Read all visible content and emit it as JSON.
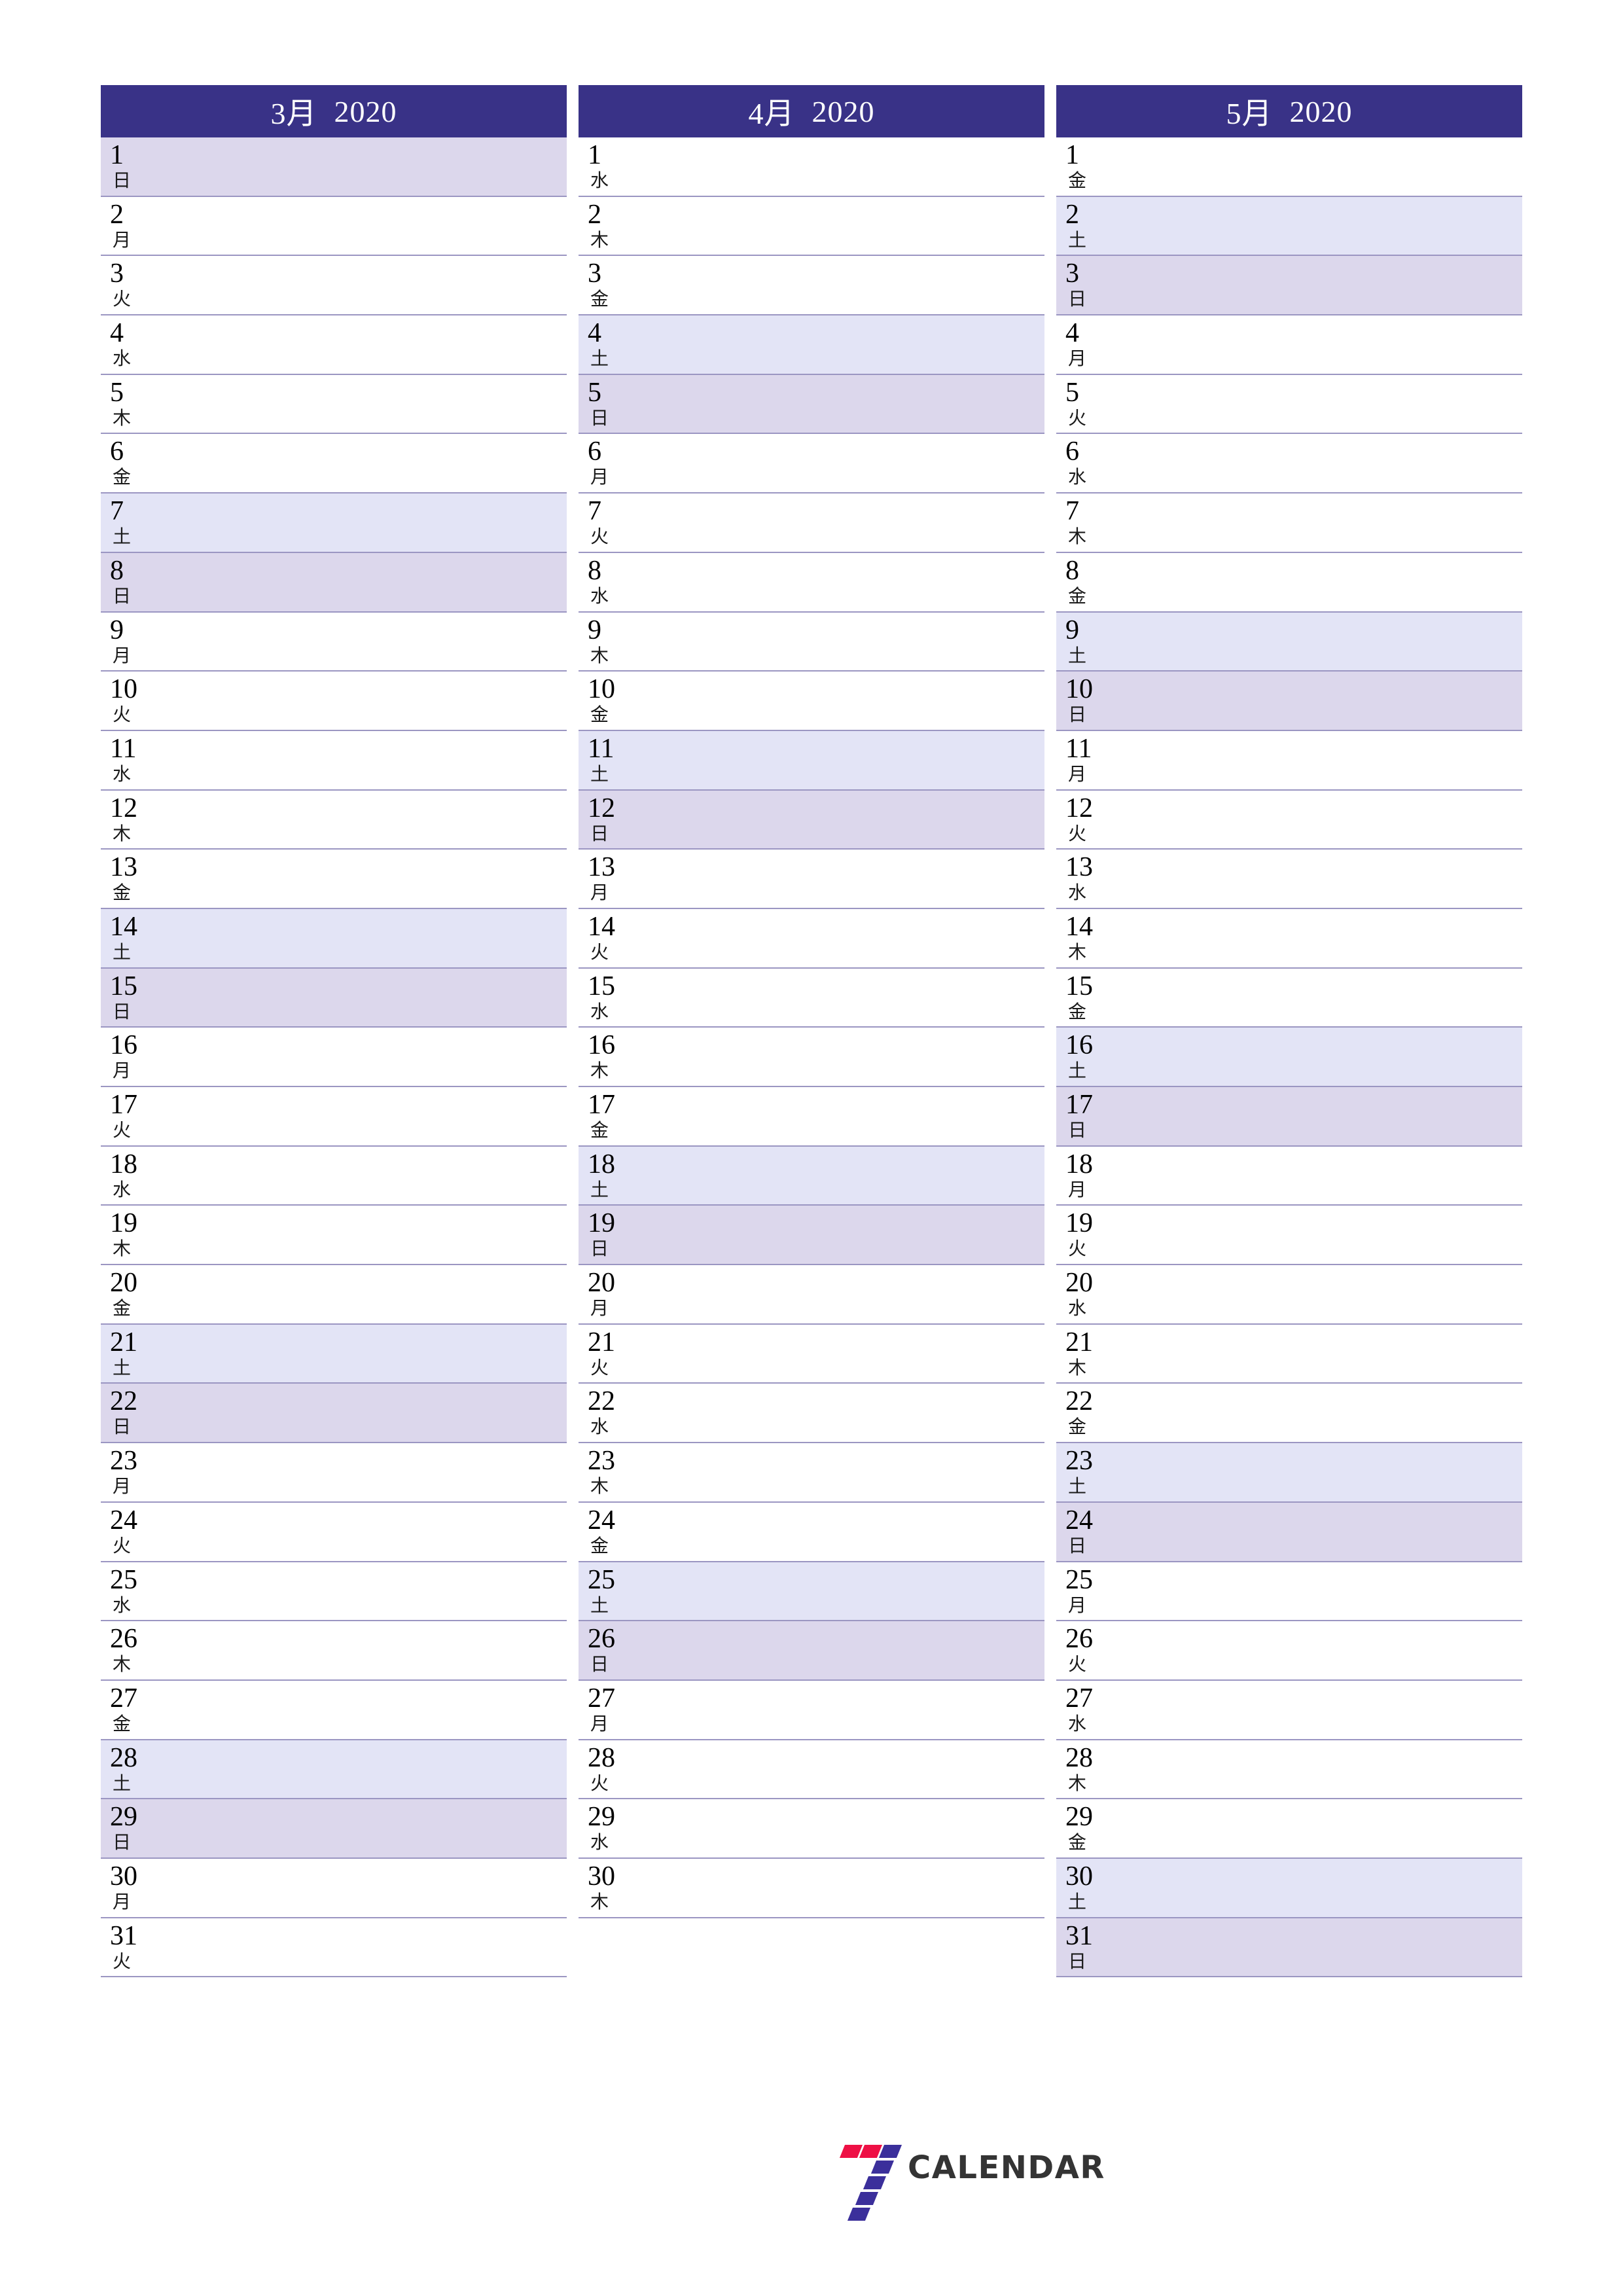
{
  "page": {
    "title": "3月 2020 / 4月 2020 / 5月 2020",
    "orientation": "portrait",
    "colors": {
      "header_background": "#393287",
      "header_text": "#ffffff",
      "saturday_background": "#e3e4f6",
      "sunday_background": "#dcd7ec",
      "row_separator": "#9b96c2",
      "logo_red": "#ee1045",
      "logo_blue": "#3b2f9b",
      "logo_word": "#343434"
    }
  },
  "brand": {
    "mark_name": "seven-logo-icon",
    "wordmark": "CALENDAR"
  },
  "months": [
    {
      "header": {
        "month": "3月",
        "year": "2020"
      },
      "days": [
        {
          "num": "1",
          "weekday": "日",
          "type": "sun"
        },
        {
          "num": "2",
          "weekday": "月",
          "type": "weekday"
        },
        {
          "num": "3",
          "weekday": "火",
          "type": "weekday"
        },
        {
          "num": "4",
          "weekday": "水",
          "type": "weekday"
        },
        {
          "num": "5",
          "weekday": "木",
          "type": "weekday"
        },
        {
          "num": "6",
          "weekday": "金",
          "type": "weekday"
        },
        {
          "num": "7",
          "weekday": "土",
          "type": "sat"
        },
        {
          "num": "8",
          "weekday": "日",
          "type": "sun"
        },
        {
          "num": "9",
          "weekday": "月",
          "type": "weekday"
        },
        {
          "num": "10",
          "weekday": "火",
          "type": "weekday"
        },
        {
          "num": "11",
          "weekday": "水",
          "type": "weekday"
        },
        {
          "num": "12",
          "weekday": "木",
          "type": "weekday"
        },
        {
          "num": "13",
          "weekday": "金",
          "type": "weekday"
        },
        {
          "num": "14",
          "weekday": "土",
          "type": "sat"
        },
        {
          "num": "15",
          "weekday": "日",
          "type": "sun"
        },
        {
          "num": "16",
          "weekday": "月",
          "type": "weekday"
        },
        {
          "num": "17",
          "weekday": "火",
          "type": "weekday"
        },
        {
          "num": "18",
          "weekday": "水",
          "type": "weekday"
        },
        {
          "num": "19",
          "weekday": "木",
          "type": "weekday"
        },
        {
          "num": "20",
          "weekday": "金",
          "type": "weekday"
        },
        {
          "num": "21",
          "weekday": "土",
          "type": "sat"
        },
        {
          "num": "22",
          "weekday": "日",
          "type": "sun"
        },
        {
          "num": "23",
          "weekday": "月",
          "type": "weekday"
        },
        {
          "num": "24",
          "weekday": "火",
          "type": "weekday"
        },
        {
          "num": "25",
          "weekday": "水",
          "type": "weekday"
        },
        {
          "num": "26",
          "weekday": "木",
          "type": "weekday"
        },
        {
          "num": "27",
          "weekday": "金",
          "type": "weekday"
        },
        {
          "num": "28",
          "weekday": "土",
          "type": "sat"
        },
        {
          "num": "29",
          "weekday": "日",
          "type": "sun"
        },
        {
          "num": "30",
          "weekday": "月",
          "type": "weekday"
        },
        {
          "num": "31",
          "weekday": "火",
          "type": "weekday"
        }
      ]
    },
    {
      "header": {
        "month": "4月",
        "year": "2020"
      },
      "days": [
        {
          "num": "1",
          "weekday": "水",
          "type": "weekday"
        },
        {
          "num": "2",
          "weekday": "木",
          "type": "weekday"
        },
        {
          "num": "3",
          "weekday": "金",
          "type": "weekday"
        },
        {
          "num": "4",
          "weekday": "土",
          "type": "sat"
        },
        {
          "num": "5",
          "weekday": "日",
          "type": "sun"
        },
        {
          "num": "6",
          "weekday": "月",
          "type": "weekday"
        },
        {
          "num": "7",
          "weekday": "火",
          "type": "weekday"
        },
        {
          "num": "8",
          "weekday": "水",
          "type": "weekday"
        },
        {
          "num": "9",
          "weekday": "木",
          "type": "weekday"
        },
        {
          "num": "10",
          "weekday": "金",
          "type": "weekday"
        },
        {
          "num": "11",
          "weekday": "土",
          "type": "sat"
        },
        {
          "num": "12",
          "weekday": "日",
          "type": "sun"
        },
        {
          "num": "13",
          "weekday": "月",
          "type": "weekday"
        },
        {
          "num": "14",
          "weekday": "火",
          "type": "weekday"
        },
        {
          "num": "15",
          "weekday": "水",
          "type": "weekday"
        },
        {
          "num": "16",
          "weekday": "木",
          "type": "weekday"
        },
        {
          "num": "17",
          "weekday": "金",
          "type": "weekday"
        },
        {
          "num": "18",
          "weekday": "土",
          "type": "sat"
        },
        {
          "num": "19",
          "weekday": "日",
          "type": "sun"
        },
        {
          "num": "20",
          "weekday": "月",
          "type": "weekday"
        },
        {
          "num": "21",
          "weekday": "火",
          "type": "weekday"
        },
        {
          "num": "22",
          "weekday": "水",
          "type": "weekday"
        },
        {
          "num": "23",
          "weekday": "木",
          "type": "weekday"
        },
        {
          "num": "24",
          "weekday": "金",
          "type": "weekday"
        },
        {
          "num": "25",
          "weekday": "土",
          "type": "sat"
        },
        {
          "num": "26",
          "weekday": "日",
          "type": "sun"
        },
        {
          "num": "27",
          "weekday": "月",
          "type": "weekday"
        },
        {
          "num": "28",
          "weekday": "火",
          "type": "weekday"
        },
        {
          "num": "29",
          "weekday": "水",
          "type": "weekday"
        },
        {
          "num": "30",
          "weekday": "木",
          "type": "weekday"
        }
      ]
    },
    {
      "header": {
        "month": "5月",
        "year": "2020"
      },
      "days": [
        {
          "num": "1",
          "weekday": "金",
          "type": "weekday"
        },
        {
          "num": "2",
          "weekday": "土",
          "type": "sat"
        },
        {
          "num": "3",
          "weekday": "日",
          "type": "sun"
        },
        {
          "num": "4",
          "weekday": "月",
          "type": "weekday"
        },
        {
          "num": "5",
          "weekday": "火",
          "type": "weekday"
        },
        {
          "num": "6",
          "weekday": "水",
          "type": "weekday"
        },
        {
          "num": "7",
          "weekday": "木",
          "type": "weekday"
        },
        {
          "num": "8",
          "weekday": "金",
          "type": "weekday"
        },
        {
          "num": "9",
          "weekday": "土",
          "type": "sat"
        },
        {
          "num": "10",
          "weekday": "日",
          "type": "sun"
        },
        {
          "num": "11",
          "weekday": "月",
          "type": "weekday"
        },
        {
          "num": "12",
          "weekday": "火",
          "type": "weekday"
        },
        {
          "num": "13",
          "weekday": "水",
          "type": "weekday"
        },
        {
          "num": "14",
          "weekday": "木",
          "type": "weekday"
        },
        {
          "num": "15",
          "weekday": "金",
          "type": "weekday"
        },
        {
          "num": "16",
          "weekday": "土",
          "type": "sat"
        },
        {
          "num": "17",
          "weekday": "日",
          "type": "sun"
        },
        {
          "num": "18",
          "weekday": "月",
          "type": "weekday"
        },
        {
          "num": "19",
          "weekday": "火",
          "type": "weekday"
        },
        {
          "num": "20",
          "weekday": "水",
          "type": "weekday"
        },
        {
          "num": "21",
          "weekday": "木",
          "type": "weekday"
        },
        {
          "num": "22",
          "weekday": "金",
          "type": "weekday"
        },
        {
          "num": "23",
          "weekday": "土",
          "type": "sat"
        },
        {
          "num": "24",
          "weekday": "日",
          "type": "sun"
        },
        {
          "num": "25",
          "weekday": "月",
          "type": "weekday"
        },
        {
          "num": "26",
          "weekday": "火",
          "type": "weekday"
        },
        {
          "num": "27",
          "weekday": "水",
          "type": "weekday"
        },
        {
          "num": "28",
          "weekday": "木",
          "type": "weekday"
        },
        {
          "num": "29",
          "weekday": "金",
          "type": "weekday"
        },
        {
          "num": "30",
          "weekday": "土",
          "type": "sat"
        },
        {
          "num": "31",
          "weekday": "日",
          "type": "sun"
        }
      ]
    }
  ]
}
